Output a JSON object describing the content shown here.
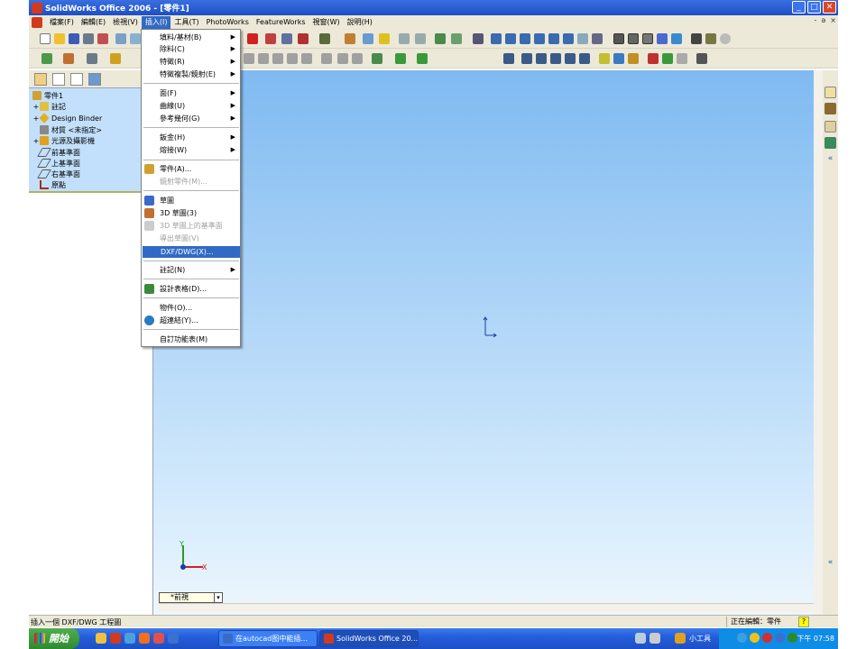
{
  "window": {
    "title": "SolidWorks Office 2006 - [零件1]",
    "controls": [
      "_",
      "□",
      "✕"
    ],
    "mdi_controls": [
      "-",
      "ə",
      "×"
    ]
  },
  "menubar": {
    "items": [
      {
        "label": "檔案(F)"
      },
      {
        "label": "編輯(E)"
      },
      {
        "label": "檢視(V)"
      },
      {
        "label": "插入(I)"
      },
      {
        "label": "工具(T)"
      },
      {
        "label": "PhotoWorks"
      },
      {
        "label": "FeatureWorks"
      },
      {
        "label": "視窗(W)"
      },
      {
        "label": "說明(H)"
      }
    ]
  },
  "insert_menu": {
    "items": [
      {
        "label": "填料/基材(B)",
        "submenu": true
      },
      {
        "label": "除料(C)",
        "submenu": true
      },
      {
        "label": "特徵(R)",
        "submenu": true
      },
      {
        "label": "特徵複製/鏡射(E)",
        "submenu": true
      },
      {
        "label": "面(F)",
        "submenu": true
      },
      {
        "label": "曲線(U)",
        "submenu": true
      },
      {
        "label": "參考幾何(G)",
        "submenu": true
      },
      {
        "label": "鈑金(H)",
        "submenu": true
      },
      {
        "label": "熔接(W)",
        "submenu": true
      },
      {
        "label": "零件(A)...",
        "icon": "part-icon"
      },
      {
        "label": "鏡射零件(M)...",
        "disabled": true
      },
      {
        "label": "草圖",
        "icon": "sketch-icon"
      },
      {
        "label": "3D 草圖(3)",
        "icon": "3d-sketch-icon"
      },
      {
        "label": "3D 草圖上的基準面",
        "disabled": true,
        "icon": "sketch-plane-icon"
      },
      {
        "label": "導出草圖(V)",
        "disabled": true
      },
      {
        "label": "DXF/DWG(X)...",
        "highlighted": true
      },
      {
        "label": "註記(N)",
        "submenu": true
      },
      {
        "label": "設計表格(D)...",
        "icon": "design-table-icon"
      },
      {
        "label": "物件(O)..."
      },
      {
        "label": "超連結(Y)...",
        "icon": "hyperlink-icon"
      },
      {
        "label": "自訂功能表(M)"
      }
    ]
  },
  "feature_tree": {
    "items": [
      {
        "label": "零件1",
        "icon": "part-icon"
      },
      {
        "label": "註記",
        "icon": "annotations-icon"
      },
      {
        "label": "Design Binder",
        "icon": "binder-icon"
      },
      {
        "label": "材質 <未指定>",
        "icon": "material-icon"
      },
      {
        "label": "光源及攝影機",
        "icon": "lights-icon"
      },
      {
        "label": "前基準面",
        "icon": "plane-icon"
      },
      {
        "label": "上基準面",
        "icon": "plane-icon"
      },
      {
        "label": "右基準面",
        "icon": "plane-icon"
      },
      {
        "label": "原點",
        "icon": "origin-icon"
      }
    ]
  },
  "viewport": {
    "view_tab": "*前視",
    "triad_x": "X",
    "triad_y": "Y"
  },
  "statusbar": {
    "message": "插入一個 DXF/DWG 工程圖",
    "editing": "正在編輯：零件",
    "help": "?"
  },
  "taskbar": {
    "start": "開始",
    "tasks": [
      {
        "label": "在autocad图中能插...",
        "icon": "word-icon"
      },
      {
        "label": "SolidWorks Office 20...",
        "icon": "solidworks-icon",
        "active": true
      }
    ],
    "tray_label": "小工具",
    "clock": "下午 07:58"
  },
  "colors": {
    "titlebar": "#245edb",
    "highlight": "#316ac5",
    "viewport_top": "#7fbaf1",
    "viewport_bottom": "#eef6fc",
    "tree_bg": "#c2e0fb"
  }
}
